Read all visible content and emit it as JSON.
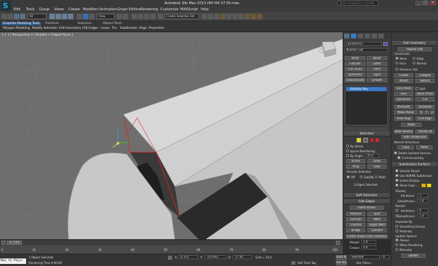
{
  "window": {
    "title": "Autodesk 3ds Max 2013 x64   Hill 07 00.max",
    "search_placeholder": "Type a keyword or phrase"
  },
  "menus": [
    "Edit",
    "Tools",
    "Group",
    "Views",
    "Create",
    "Modifiers",
    "Animation",
    "Graph Editors",
    "Rendering",
    "Customize",
    "MAXScript",
    "Help"
  ],
  "toolbar": {
    "selection_filter": "All",
    "reference_coord": "View",
    "named_selection": "Create Selection Set"
  },
  "ribbon": {
    "tabs": [
      "Graphite Modeling Tools",
      "Freeform",
      "Selection",
      "Object Paint"
    ],
    "subtabs": [
      "Polygon Modeling",
      "Modify Selection",
      "Edit",
      "Geometry (All)",
      "Edges",
      "Loops",
      "Tris",
      "Subdivision",
      "Align",
      "Properties"
    ]
  },
  "viewport": {
    "label": "[ + ] [ Perspective ] [ Shaded + Edged Faces ]"
  },
  "command_panel": {
    "object_name": "Cylinder013",
    "modifier_list": "Modifier List",
    "modifier_buttons": [
      "Bend",
      "Bevel",
      "Extrude",
      "Lathe",
      "FFD 3x3x3",
      "Shell",
      "Symmetry",
      "Taper",
      "TurboSmooth",
      "Smooth"
    ],
    "stack_item": "Editable Poly",
    "selection": {
      "title": "Selection",
      "by_vertex": "By Vertex",
      "ignore_backfacing": "Ignore Backfacing",
      "by_angle": "By Angle:",
      "by_angle_value": "45.0",
      "shrink": "Shrink",
      "grow": "Grow",
      "ring": "Ring",
      "loop": "Loop",
      "preview": "Preview Selection",
      "preview_off": "Off",
      "preview_subobj": "SubObj",
      "preview_multi": "Multi",
      "status": "3 Edges Selected"
    },
    "soft_selection": "Soft Selection",
    "edit_edges": {
      "title": "Edit Edges",
      "insert_vertex": "Insert Vertex",
      "remove": "Remove",
      "split": "Split",
      "extrude": "Extrude",
      "weld": "Weld",
      "chamfer": "Chamfer",
      "target_weld": "Target Weld",
      "bridge": "Bridge",
      "connect": "Connect",
      "create_shape": "Create Shape From Selection",
      "weight_label": "Weight:",
      "weight_value": "1.0",
      "crease_label": "Crease:",
      "crease_value": "0.0"
    }
  },
  "right_panel": {
    "edit_geometry": "Edit Geometry",
    "repeat_last": "Repeat Last",
    "constraints": "Constraints",
    "none": "None",
    "edge": "Edge",
    "face": "Face",
    "normal": "Normal",
    "preserve_uvs": "Preserve UVs",
    "create": "Create",
    "collapse": "Collapse",
    "attach": "Attach",
    "detach": "Detach",
    "slice_plane": "Slice Plane",
    "split": "Split",
    "slice": "Slice",
    "reset_plane": "Reset Plane",
    "quickslice": "QuickSlice",
    "cut": "Cut",
    "msmooth": "MSmooth",
    "tessellate": "Tessellate",
    "make_planar": "Make Planar",
    "x": "X",
    "y": "Y",
    "z": "Z",
    "view_align": "View Align",
    "grid_align": "Grid Align",
    "relax": "Relax",
    "hide_selected": "Hide Selected",
    "unhide_all": "Unhide All",
    "hide_unselected": "Hide Unselected",
    "named_selections": "Named Selections:",
    "copy": "Copy",
    "paste": "Paste",
    "delete_isolated": "Delete Isolated Vertices",
    "full_interactivity": "Full Interactivity",
    "subdivision_surface": "Subdivision Surface",
    "smooth_result": "Smooth Result",
    "use_nurms": "Use NURMS Subdivision",
    "isoline_display": "Isoline Display",
    "show_cage": "Show Cage......",
    "display": "Display",
    "iterations_label": "Iterations:",
    "iterations_value": "1",
    "smoothness_label": "Smoothness:",
    "smoothness_value": "1.0",
    "render": "Render",
    "r_iterations_value": "0",
    "r_smoothness_value": "1.0",
    "separate_by": "Separate By",
    "smoothing_groups": "Smoothing Groups",
    "materials": "Materials",
    "update_options": "Update Options",
    "always": "Always",
    "when_rendering": "When Rendering",
    "manually": "Manually",
    "update": "Update"
  },
  "bottom": {
    "frame_counter": "0 / 100",
    "ticks": [
      "0",
      "10",
      "20",
      "30",
      "40",
      "50",
      "60",
      "70",
      "80",
      "90",
      "100"
    ],
    "maxscript": "Max to Physc",
    "status": "1 Object Selected",
    "prompt": "Rendering Time  0:00:00",
    "coord_x": "6.313",
    "coord_y": "-223.851",
    "coord_z": "-17.65",
    "grid": "Grid = 10.0",
    "add_time_tag": "Add Time Tag",
    "auto_key": "Auto Key",
    "set_key": "Set Key",
    "selected": "Selected",
    "key_filters": "Key Filters...",
    "frame_value": "0"
  },
  "colors": {
    "accent": "#2f5b8a",
    "viewport_bg": "#6e6e6e",
    "selection_highlight": "#e02020",
    "yellow": "#e8d400"
  }
}
